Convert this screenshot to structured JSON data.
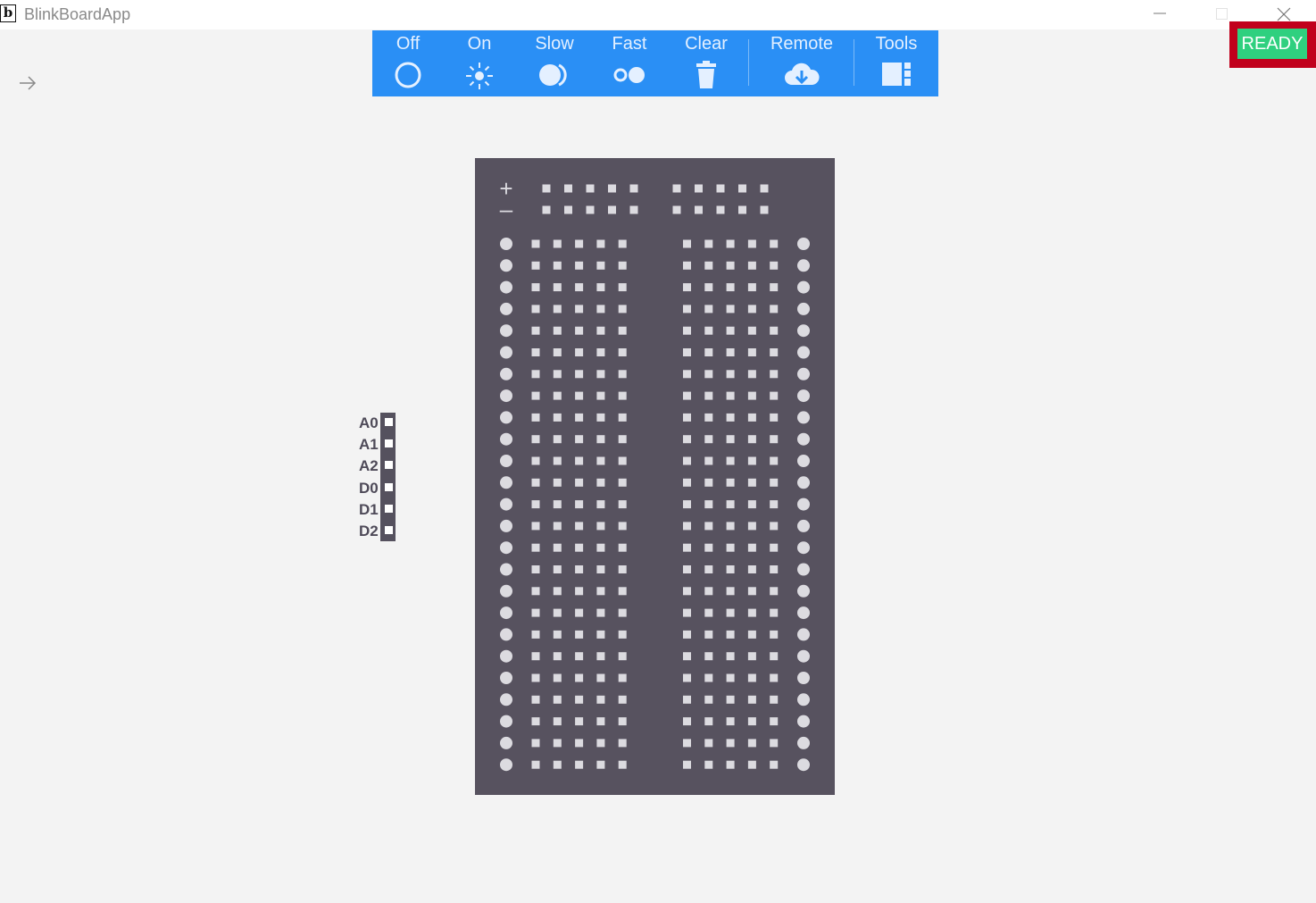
{
  "window": {
    "title": "BlinkBoardApp",
    "icon_glyph": "b",
    "icon_name": "app-logo-icon",
    "controls": [
      "minimize-icon",
      "maximize-icon",
      "close-icon"
    ]
  },
  "nav": {
    "back_icon": "arrow-right-icon"
  },
  "toolbar": {
    "color": "#2a8ff5",
    "items": [
      {
        "label": "Off",
        "icon": "circle-outline-icon"
      },
      {
        "label": "On",
        "icon": "sun-icon"
      },
      {
        "label": "Slow",
        "icon": "slow-blink-icon"
      },
      {
        "label": "Fast",
        "icon": "fast-blink-icon"
      },
      {
        "label": "Clear",
        "icon": "trash-icon"
      },
      {
        "label": "Remote",
        "icon": "cloud-download-icon"
      },
      {
        "label": "Tools",
        "icon": "tools-panel-icon"
      }
    ]
  },
  "status": {
    "label": "READY",
    "badge_color": "#2fd07f",
    "frame_color": "#c1001c"
  },
  "pins": {
    "labels": [
      "A0",
      "A1",
      "A2",
      "D0",
      "D1",
      "D2"
    ]
  },
  "breadboard": {
    "rail_symbols": {
      "plus": "+",
      "minus": "–"
    },
    "rail_holes_per_group": 5,
    "rail_groups": 2,
    "rows": 25,
    "holes_per_side": 5,
    "color": "#57525f"
  }
}
